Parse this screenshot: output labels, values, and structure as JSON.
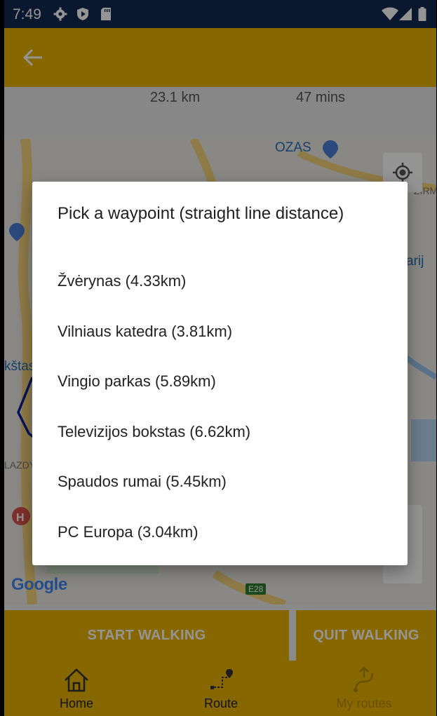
{
  "status_bar": {
    "time": "7:49",
    "left_icons": [
      "gear-icon",
      "shield-play-icon",
      "sd-card-icon"
    ],
    "right_icons": [
      "wifi-icon",
      "cell-signal-icon",
      "battery-icon"
    ]
  },
  "app_bar": {
    "back_icon": "arrow-left-icon"
  },
  "stats": {
    "distance": "23.1 km",
    "duration": "47 mins"
  },
  "map": {
    "labels": {
      "ozas": "OZAS",
      "zirmunai": "ŽIRM",
      "arij": "arij",
      "kstas": "kštas",
      "lazdy": "LAZDY"
    },
    "google_logo": "Google",
    "road_badge": "E28",
    "locate_icon": "my-location-icon"
  },
  "actions": {
    "start": "START WALKING",
    "quit": "QUIT WALKING"
  },
  "bottom_nav": [
    {
      "label": "Home",
      "icon": "home-icon"
    },
    {
      "label": "Route",
      "icon": "route-icon"
    },
    {
      "label": "My routes",
      "icon": "my-routes-icon"
    }
  ],
  "dialog": {
    "title": "Pick a waypoint (straight line distance)",
    "items": [
      "Žvėrynas (4.33km)",
      "Vilniaus katedra (3.81km)",
      "Vingio parkas (5.89km)",
      "Televizijos bokstas (6.62km)",
      "Spaudos rumai (5.45km)",
      "PC Europa (3.04km)"
    ]
  },
  "colors": {
    "accent": "#e9b200",
    "status_bar": "#102a52",
    "route_line": "#0d1fa0"
  }
}
